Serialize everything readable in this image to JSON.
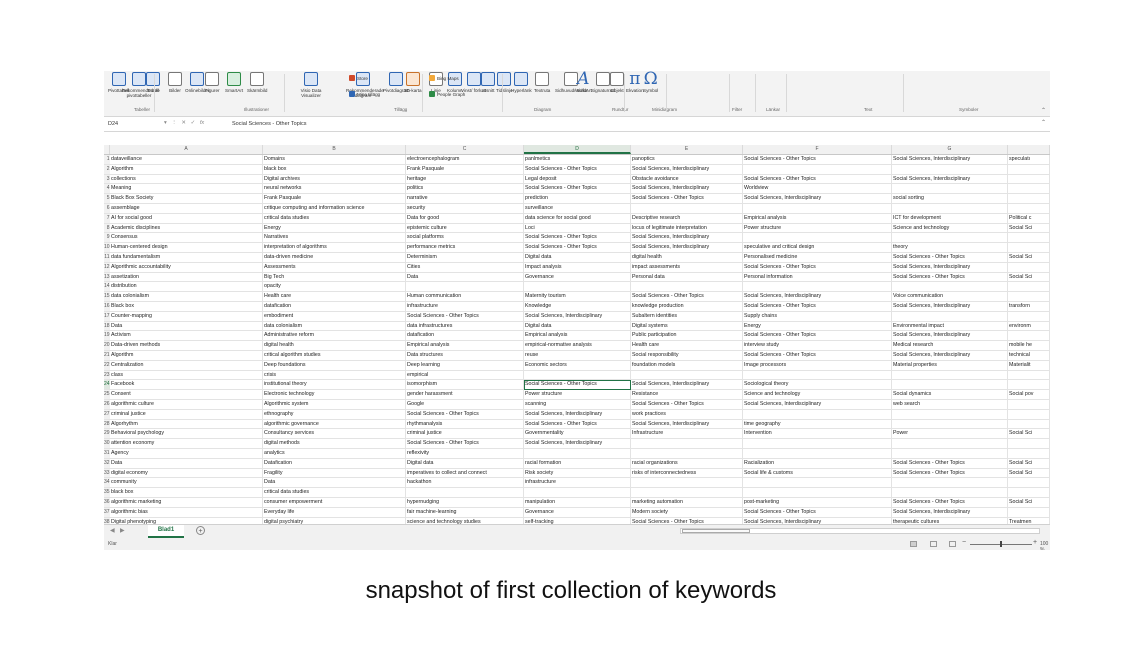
{
  "ribbon": {
    "buttons": [
      {
        "label": "Pivottabell",
        "icon": "pivot-table-icon"
      },
      {
        "label": "Rekommenderade pivottabeller",
        "icon": "recommended-pivot-icon"
      },
      {
        "label": "Tabell",
        "icon": "table-icon"
      },
      {
        "label": "Bilder",
        "icon": "pictures-icon"
      },
      {
        "label": "Onlinebilder",
        "icon": "online-pictures-icon"
      },
      {
        "label": "Figurer",
        "icon": "shapes-icon"
      },
      {
        "label": "SmartArt",
        "icon": "smartart-icon"
      },
      {
        "label": "Skärmbild",
        "icon": "screenshot-icon"
      },
      {
        "label": "Visio Data Visualizer",
        "icon": "visio-icon"
      },
      {
        "label": "Rekommenderade diagram",
        "icon": "recommended-charts-icon"
      },
      {
        "label": "Pivotdiagram",
        "icon": "pivot-chart-icon"
      },
      {
        "label": "3D-karta",
        "icon": "3d-map-icon"
      },
      {
        "label": "Linje",
        "icon": "sparkline-line-icon"
      },
      {
        "label": "Kolumn",
        "icon": "sparkline-column-icon"
      },
      {
        "label": "Vinst/ förlust",
        "icon": "sparkline-winloss-icon"
      },
      {
        "label": "Utsnitt",
        "icon": "slicer-icon"
      },
      {
        "label": "Tidslinje",
        "icon": "timeline-icon"
      },
      {
        "label": "Hyperlänk",
        "icon": "hyperlink-icon"
      },
      {
        "label": "Textruta",
        "icon": "textbox-icon"
      },
      {
        "label": "Sidhuvud/ sidfot",
        "icon": "header-footer-icon"
      },
      {
        "label": "WordArt",
        "icon": "wordart-icon"
      },
      {
        "label": "Signaturrad",
        "icon": "signature-line-icon"
      },
      {
        "label": "Objekt",
        "icon": "object-icon"
      },
      {
        "label": "Ekvation",
        "icon": "equation-icon"
      },
      {
        "label": "Symbol",
        "icon": "symbol-icon"
      }
    ],
    "small_buttons": {
      "store": "Store",
      "my_addins": "Mina tillägg",
      "bing_maps": "Bing Maps",
      "people_graph": "People Graph"
    },
    "groups": [
      "Tabeller",
      "Illustrationer",
      "Tillägg",
      "Diagram",
      "Rundtur",
      "Minidiagram",
      "Filter",
      "Länkar",
      "Text",
      "Symboler"
    ],
    "accent_color": "#217346"
  },
  "formula_bar": {
    "name_box": "D24",
    "fx_label": "fx",
    "formula": "Social Sciences - Other Topics"
  },
  "columns": [
    "A",
    "B",
    "C",
    "D",
    "E",
    "F",
    "G",
    ""
  ],
  "selected_column": "D",
  "selected_row": "24",
  "rows": [
    [
      "1",
      "dataveillance",
      "Domains",
      "electroencephalogram",
      "panlmetics",
      "panoptics",
      "Social Sciences - Other Topics",
      "Social Sciences, Interdisciplinary",
      "speculatı"
    ],
    [
      "2",
      "Algorithm",
      "black box",
      "Frank Pasquale",
      "Social Sciences - Other Topics",
      "Social Sciences, Interdisciplinary",
      "",
      "",
      ""
    ],
    [
      "3",
      "collections",
      "Digital archives",
      "heritage",
      "Legal deposit",
      "Obstacle avoidance",
      "Social Sciences - Other Topics",
      "Social Sciences, Interdisciplinary",
      ""
    ],
    [
      "4",
      "Meaning",
      "neural networks",
      "politics",
      "Social Sciences - Other Topics",
      "Social Sciences, Interdisciplinary",
      "Worldview",
      "",
      ""
    ],
    [
      "5",
      "Black Box Society",
      "Frank Pasquale",
      "narrative",
      "prediction",
      "Social Sciences - Other Topics",
      "Social Sciences, Interdisciplinary",
      "social sorting",
      ""
    ],
    [
      "6",
      "assemblage",
      "critique computing and information science",
      "security",
      "surveillance",
      "",
      "",
      "",
      ""
    ],
    [
      "7",
      "AI for social good",
      "critical data studies",
      "Data for good",
      "data science for social good",
      "Descriptive research",
      "Empirical analysis",
      "ICT for development",
      "Political c"
    ],
    [
      "8",
      "Academic disciplines",
      "Energy",
      "epistemic culture",
      "Loci",
      "locus of legitimate interpretation",
      "Power structure",
      "Science and technology",
      "Social Sci"
    ],
    [
      "9",
      "Consensus",
      "Narratives",
      "social platforms",
      "Social Sciences - Other Topics",
      "Social Sciences, Interdisciplinary",
      "",
      "",
      ""
    ],
    [
      "10",
      "Human-centered design",
      "interpretation of algorithms",
      "performance metrics",
      "Social Sciences - Other Topics",
      "Social Sciences, Interdisciplinary",
      "speculative and critical design",
      "theory",
      ""
    ],
    [
      "11",
      "data fundamentalism",
      "data-driven medicine",
      "Determinism",
      "Digital data",
      "digital health",
      "Personalised medicine",
      "Social Sciences - Other Topics",
      "Social Sci"
    ],
    [
      "12",
      "Algorithmic accountability",
      "Assessments",
      "Cities",
      "Impact analysis",
      "impact assessments",
      "Social Sciences - Other Topics",
      "Social Sciences, Interdisciplinary",
      ""
    ],
    [
      "13",
      "assetization",
      "Big Tech",
      "Data",
      "Governance",
      "Personal data",
      "Personal information",
      "Social Sciences - Other Topics",
      "Social Sci"
    ],
    [
      "14",
      "distribution",
      "opacity",
      "",
      "",
      "",
      "",
      "",
      ""
    ],
    [
      "15",
      "data colonialism",
      "Health care",
      "Human communication",
      "Maternity tourism",
      "Social Sciences - Other Topics",
      "Social Sciences, Interdisciplinary",
      "Voice communication",
      ""
    ],
    [
      "16",
      "Black box",
      "datafication",
      "infrastructure",
      "Knowledge",
      "knowledge production",
      "Social Sciences - Other Topics",
      "Social Sciences, Interdisciplinary",
      "transforn"
    ],
    [
      "17",
      "Counter-mapping",
      "embodiment",
      "Social Sciences - Other Topics",
      "Social Sciences, Interdisciplinary",
      "Subaltern identities",
      "Supply chains",
      "",
      ""
    ],
    [
      "18",
      "Data",
      "data colonialism",
      "data infrastructures",
      "Digital data",
      "Digital systems",
      "Energy",
      "Environmental impact",
      "environm"
    ],
    [
      "19",
      "Activism",
      "Administrative reform",
      "datafication",
      "Empirical analysis",
      "Public participation",
      "Social Sciences - Other Topics",
      "Social Sciences, Interdisciplinary",
      ""
    ],
    [
      "20",
      "Data-driven methods",
      "digital health",
      "Empirical analysis",
      "empirical-normative analysis",
      "Health care",
      "interview study",
      "Medical research",
      "mobile he"
    ],
    [
      "21",
      "Algorithm",
      "critical algorithm studies",
      "Data structures",
      "reuse",
      "Social responsibility",
      "Social Sciences - Other Topics",
      "Social Sciences, Interdisciplinary",
      "technical"
    ],
    [
      "22",
      "Centralization",
      "Deep foundations",
      "Deep learning",
      "Economic sectors",
      "foundation models",
      "Image processors",
      "Material properties",
      "Materialit"
    ],
    [
      "23",
      "class",
      "crisis",
      "empirical",
      "",
      "",
      "",
      "",
      ""
    ],
    [
      "24",
      "Facebook",
      "institutional theory",
      "isomorphism",
      "Social Sciences - Other Topics",
      "Social Sciences, Interdisciplinary",
      "Sociological theory",
      "",
      ""
    ],
    [
      "25",
      "Consent",
      "Electronic technology",
      "gender harassment",
      "Power structure",
      "Resistance",
      "Science and technology",
      "Social dynamics",
      "Social pov"
    ],
    [
      "26",
      "algorithmic culture",
      "Algorithmic system",
      "Google",
      "scanning",
      "Social Sciences - Other Topics",
      "Social Sciences, Interdisciplinary",
      "web search",
      ""
    ],
    [
      "27",
      "criminal justice",
      "ethnography",
      "Social Sciences - Other Topics",
      "Social Sciences, Interdisciplinary",
      "work practices",
      "",
      "",
      ""
    ],
    [
      "28",
      "Algorhythm",
      "algorithmic governance",
      "rhythmanalysis",
      "Social Sciences - Other Topics",
      "Social Sciences, Interdisciplinary",
      "time geography",
      "",
      ""
    ],
    [
      "29",
      "Behavioral psychology",
      "Consultancy services",
      "criminal justice",
      "Governmentality",
      "Infrastructure",
      "Intervention",
      "Power",
      "Social Sci"
    ],
    [
      "30",
      "attention economy",
      "digital methods",
      "Social Sciences - Other Topics",
      "Social Sciences, Interdisciplinary",
      "",
      "",
      "",
      ""
    ],
    [
      "31",
      "Agency",
      "analytics",
      "reflexivity",
      "",
      "",
      "",
      "",
      ""
    ],
    [
      "32",
      "Data",
      "Datafication",
      "Digital data",
      "racial formation",
      "racial organizations",
      "Racialization",
      "Social Sciences - Other Topics",
      "Social Sci"
    ],
    [
      "33",
      "digital economy",
      "Fragility",
      "imperatives to collect and connect",
      "Risk society",
      "risks of interconnectedness",
      "Social life & customs",
      "Social Sciences - Other Topics",
      "Social Sci"
    ],
    [
      "34",
      "community",
      "Data",
      "hackathon",
      "infrastructure",
      "",
      "",
      "",
      ""
    ],
    [
      "35",
      "black box",
      "critical data studies",
      "",
      "",
      "",
      "",
      "",
      ""
    ],
    [
      "36",
      "algorithmic marketing",
      "consumer empowerment",
      "hypernudging",
      "manipulation",
      "marketing automation",
      "post-marketing",
      "Social Sciences - Other Topics",
      "Social Sci"
    ],
    [
      "37",
      "algorithmic bias",
      "Everyday life",
      "fair machine-learning",
      "Governance",
      "Modern society",
      "Social Sciences - Other Topics",
      "Social Sciences, Interdisciplinary",
      ""
    ],
    [
      "38",
      "Digital phenotyping",
      "digital psychiatry",
      "science and technology studies",
      "self-tracking",
      "Social Sciences - Other Topics",
      "Social Sciences, Interdisciplinary",
      "therapeutic cultures",
      "Treatmen"
    ]
  ],
  "sheet_tabs": {
    "active": "Blad1",
    "add_label": "+"
  },
  "status_bar": {
    "status": "Klar",
    "zoom": "100 %"
  },
  "caption": "snapshot of first collection of keywords"
}
